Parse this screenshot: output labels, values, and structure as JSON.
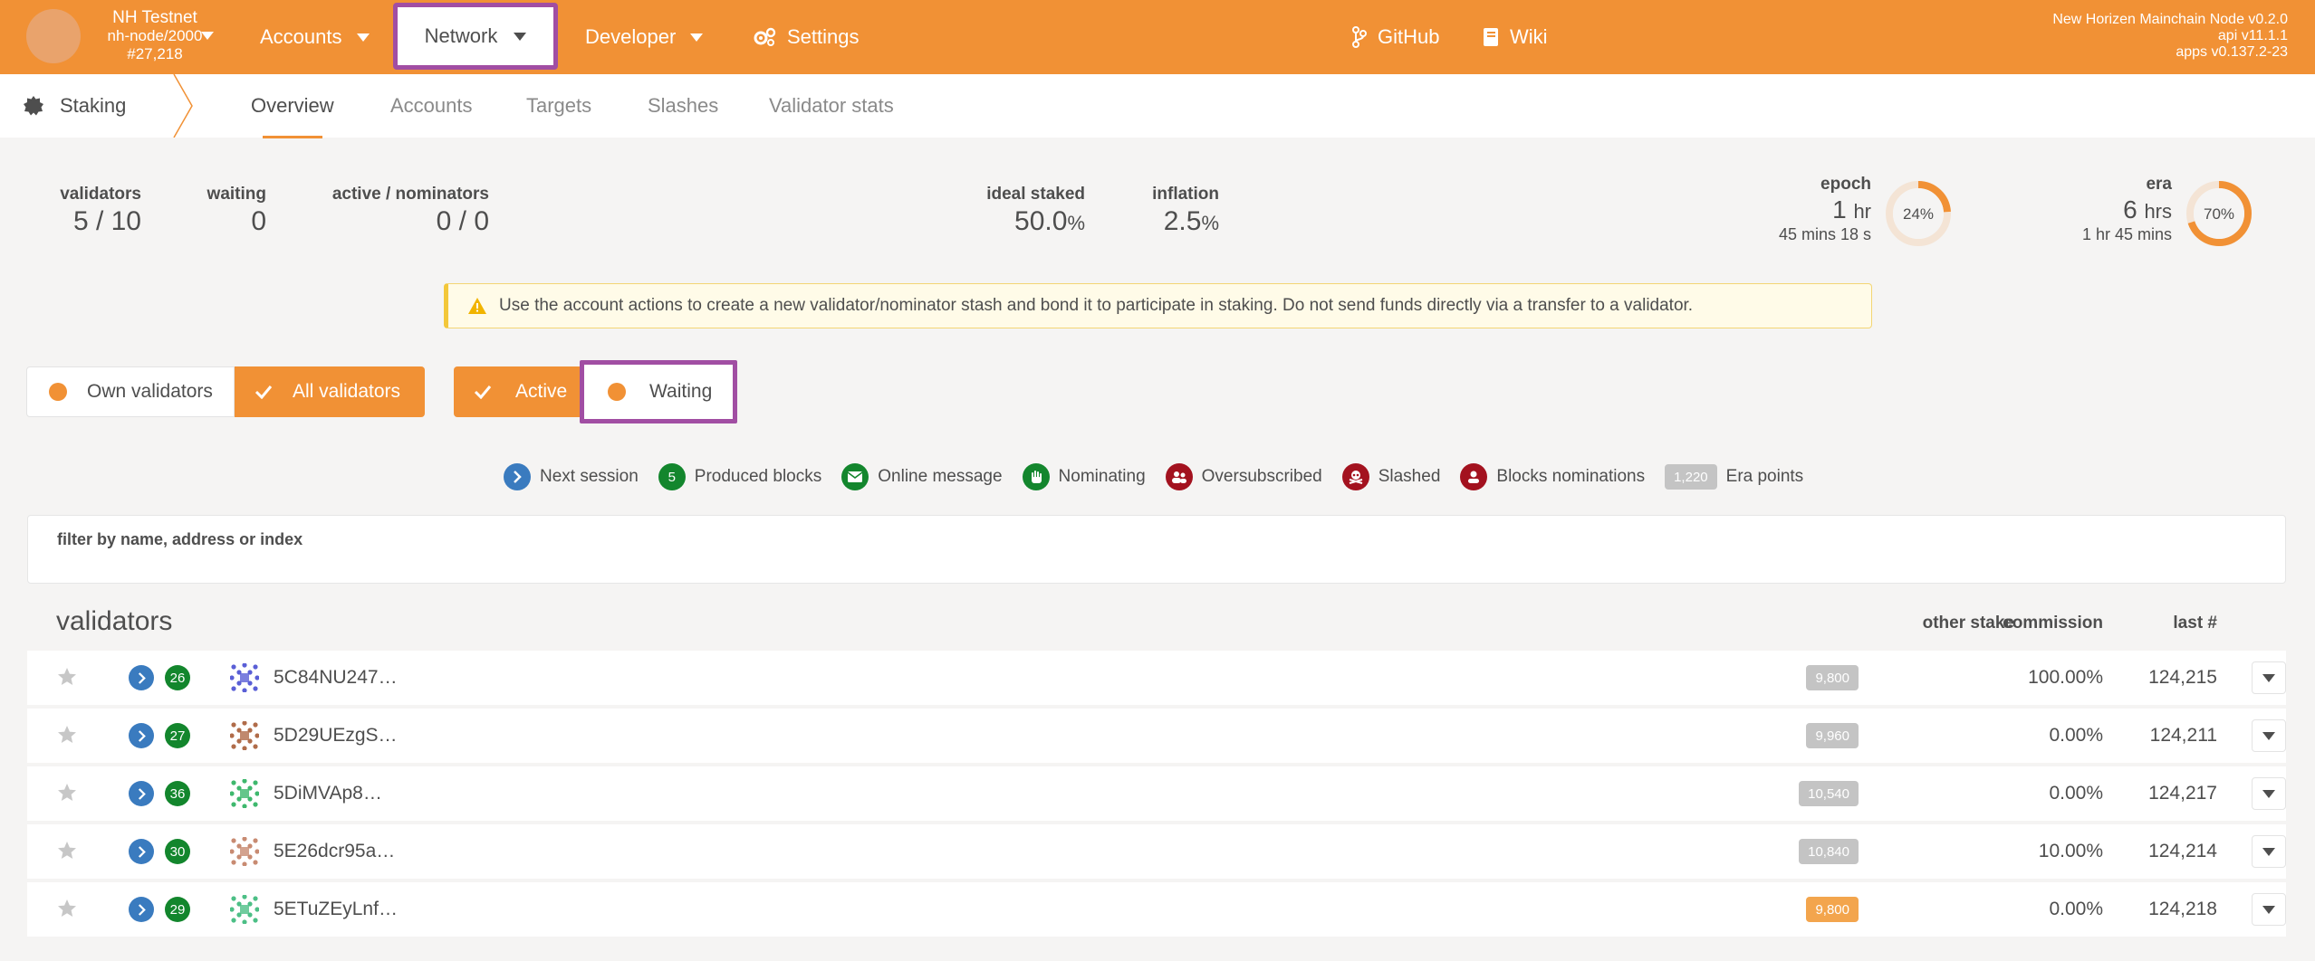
{
  "topbar": {
    "chain_name": "NH Testnet",
    "node": "nh-node/2000",
    "block": "#27,218",
    "nav": {
      "accounts": "Accounts",
      "network": "Network",
      "developer": "Developer",
      "settings": "Settings",
      "github": "GitHub",
      "wiki": "Wiki"
    },
    "versions": {
      "node": "New Horizen Mainchain Node v0.2.0",
      "api": "api v11.1.1",
      "apps": "apps v0.137.2-23"
    }
  },
  "subbar": {
    "section": "Staking",
    "tabs": [
      "Overview",
      "Accounts",
      "Targets",
      "Slashes",
      "Validator stats"
    ],
    "active_tab": "Overview"
  },
  "summary": {
    "validators_label": "validators",
    "validators_value": "5 / 10",
    "waiting_label": "waiting",
    "waiting_value": "0",
    "active_nominators_label": "active / nominators",
    "active_nominators_value": "0 / 0",
    "ideal_staked_label": "ideal staked",
    "ideal_staked_value": "50.0",
    "ideal_staked_unit": "%",
    "inflation_label": "inflation",
    "inflation_value": "2.5",
    "inflation_unit": "%",
    "epoch_label": "epoch",
    "epoch_value": "1",
    "epoch_unit": "hr",
    "epoch_remaining": "45 mins 18 s",
    "epoch_percent_label": "24%",
    "epoch_percent": 24,
    "era_label": "era",
    "era_value": "6",
    "era_unit": "hrs",
    "era_remaining": "1 hr 45 mins",
    "era_percent_label": "70%",
    "era_percent": 70
  },
  "warning": "Use the account actions to create a new validator/nominator stash and bond it to participate in staking. Do not send funds directly via a transfer to a validator.",
  "filters": {
    "own_validators": "Own validators",
    "all_validators": "All validators",
    "active": "Active",
    "waiting": "Waiting"
  },
  "legend": {
    "next_session": "Next session",
    "produced_blocks_badge": "5",
    "produced_blocks": "Produced blocks",
    "online_message": "Online message",
    "nominating": "Nominating",
    "oversubscribed": "Oversubscribed",
    "slashed": "Slashed",
    "blocks_nominations": "Blocks nominations",
    "era_points_badge": "1,220",
    "era_points": "Era points"
  },
  "filter_box": {
    "label": "filter by name, address or index",
    "value": ""
  },
  "table": {
    "title": "validators",
    "col_other_stake": "other stake",
    "col_commission": "commission",
    "col_last": "last #",
    "rows": [
      {
        "blocks": "26",
        "address": "5C84NU247…",
        "stake": "9,800",
        "commission": "100.00%",
        "last": "124,215",
        "icon_color": "#5a5fd6",
        "stake_highlight": false
      },
      {
        "blocks": "27",
        "address": "5D29UEzgS…",
        "stake": "9,960",
        "commission": "0.00%",
        "last": "124,211",
        "icon_color": "#b06c4a",
        "stake_highlight": false
      },
      {
        "blocks": "36",
        "address": "5DiMVAp8…",
        "stake": "10,540",
        "commission": "0.00%",
        "last": "124,217",
        "icon_color": "#3fb86e",
        "stake_highlight": false
      },
      {
        "blocks": "30",
        "address": "5E26dcr95a…",
        "stake": "10,840",
        "commission": "10.00%",
        "last": "124,214",
        "icon_color": "#c88b72",
        "stake_highlight": false
      },
      {
        "blocks": "29",
        "address": "5ETuZEyLnf…",
        "stake": "9,800",
        "commission": "0.00%",
        "last": "124,218",
        "icon_color": "#4cbf86",
        "stake_highlight": true
      }
    ]
  },
  "colors": {
    "brand": "#f19135",
    "highlight": "#a14ea3",
    "blue": "#3a7bbf",
    "green": "#13862d",
    "red": "#a3121f"
  }
}
